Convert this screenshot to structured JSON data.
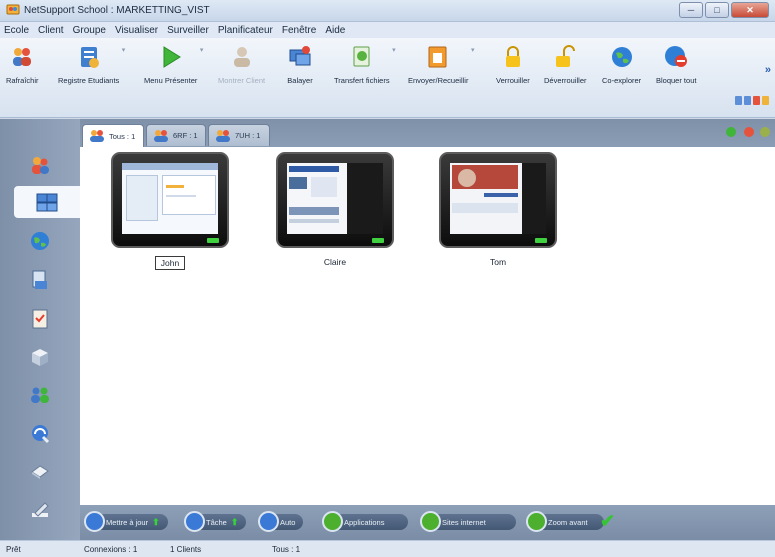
{
  "window": {
    "title": "NetSupport School : MARKETTING_VIST",
    "controls": [
      "─",
      "□",
      "✕"
    ]
  },
  "menu": [
    "Ecole",
    "Client",
    "Groupe",
    "Visualiser",
    "Surveiller",
    "Planificateur",
    "Fenêtre",
    "Aide"
  ],
  "toolbar": {
    "buttons": [
      {
        "label": "Rafraîchir",
        "icon": "refresh-users-icon",
        "enabled": true
      },
      {
        "label": "Registre Etudiants",
        "icon": "student-register-icon",
        "enabled": true
      },
      {
        "label": "Menu Présenter",
        "icon": "play-icon",
        "enabled": true
      },
      {
        "label": "Montrer Client",
        "icon": "show-client-icon",
        "enabled": false
      },
      {
        "label": "Balayer",
        "icon": "scan-icon",
        "enabled": true
      },
      {
        "label": "Transfert fichiers",
        "icon": "file-transfer-icon",
        "enabled": true
      },
      {
        "label": "Envoyer/Recueillir",
        "icon": "send-collect-icon",
        "enabled": true
      },
      {
        "label": "Verrouiller",
        "icon": "lock-icon",
        "enabled": true
      },
      {
        "label": "Déverrouiller",
        "icon": "unlock-icon",
        "enabled": true
      },
      {
        "label": "Co-explorer",
        "icon": "globe-icon",
        "enabled": true
      },
      {
        "label": "Bloquer tout",
        "icon": "block-icon",
        "enabled": true
      }
    ],
    "more": "»"
  },
  "tabs": [
    {
      "label": "Tous : 1",
      "active": true
    },
    {
      "label": "6RF : 1",
      "active": false
    },
    {
      "label": "7UH : 1",
      "active": false
    }
  ],
  "clients": [
    {
      "name": "John",
      "selected": true
    },
    {
      "name": "Claire",
      "selected": false
    },
    {
      "name": "Tom",
      "selected": false
    }
  ],
  "bottom_actions": [
    {
      "label": "Mettre à jour",
      "color": "#3a7ad6"
    },
    {
      "label": "Tâche",
      "color": "#3a7ad6"
    },
    {
      "label": "Auto",
      "color": "#3a7ad6"
    },
    {
      "label": "Applications",
      "color": "#4caf2e"
    },
    {
      "label": "Sites internet",
      "color": "#4caf2e"
    },
    {
      "label": "Zoom avant",
      "color": "#4caf2e"
    }
  ],
  "status": {
    "state": "Prêt",
    "connections": "Connexions : 1",
    "clients": "1 Clients",
    "group": "Tous : 1"
  }
}
